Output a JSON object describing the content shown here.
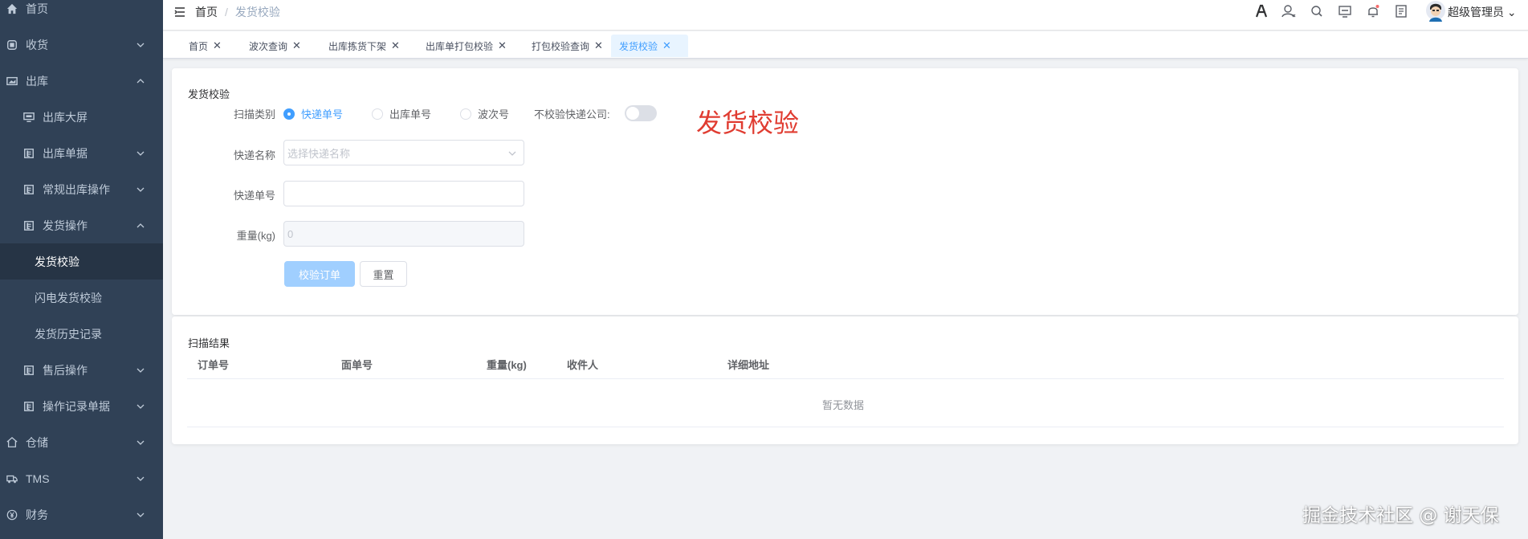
{
  "sidebar": {
    "items": [
      {
        "label": "首页",
        "icon": "home-icon"
      },
      {
        "label": "收货",
        "icon": "receive-icon",
        "arrow": "down"
      },
      {
        "label": "出库",
        "icon": "outbound-icon",
        "arrow": "up"
      },
      {
        "label": "出库大屏",
        "icon": "monitor-icon"
      },
      {
        "label": "出库单据",
        "icon": "document-icon",
        "arrow": "down"
      },
      {
        "label": "常规出库操作",
        "icon": "document-icon",
        "arrow": "down"
      },
      {
        "label": "发货操作",
        "icon": "document-icon",
        "arrow": "up"
      },
      {
        "label": "发货校验",
        "active": true
      },
      {
        "label": "闪电发货校验"
      },
      {
        "label": "发货历史记录"
      },
      {
        "label": "售后操作",
        "icon": "document-icon",
        "arrow": "down"
      },
      {
        "label": "操作记录单据",
        "icon": "document-icon",
        "arrow": "down"
      },
      {
        "label": "仓储",
        "icon": "warehouse-icon",
        "arrow": "down"
      },
      {
        "label": "TMS",
        "icon": "truck-icon",
        "arrow": "down"
      },
      {
        "label": "财务",
        "icon": "yen-icon",
        "arrow": "down"
      }
    ]
  },
  "header": {
    "breadcrumb": {
      "home": "首页",
      "separator": "/",
      "current": "发货校验"
    },
    "user_name": "超级管理员",
    "icons": [
      "font-size-icon",
      "user-icon",
      "search-icon",
      "screen-icon",
      "bell-icon",
      "doc-icon"
    ]
  },
  "tags": [
    {
      "label": "首页"
    },
    {
      "label": "波次查询"
    },
    {
      "label": "出库拣货下架"
    },
    {
      "label": "出库单打包校验"
    },
    {
      "label": "打包校验查询"
    },
    {
      "label": "发货校验",
      "active": true
    }
  ],
  "form": {
    "card_title": "发货校验",
    "scan_type_label": "扫描类别",
    "radios": [
      {
        "label": "快递单号",
        "checked": true
      },
      {
        "label": "出库单号",
        "checked": false
      },
      {
        "label": "波次号",
        "checked": false
      }
    ],
    "no_check_label": "不校验快递公司:",
    "no_check_on": false,
    "express_name_label": "快递名称",
    "express_name_placeholder": "选择快递名称",
    "express_no_label": "快递单号",
    "express_no_value": "",
    "weight_label": "重量(kg)",
    "weight_value": "0",
    "submit_label": "校验订单",
    "reset_label": "重置",
    "big_title": "发货校验"
  },
  "result": {
    "card_title": "扫描结果",
    "columns": [
      "订单号",
      "面单号",
      "重量(kg)",
      "收件人",
      "详细地址"
    ],
    "empty_text": "暂无数据"
  },
  "watermark": "掘金技术社区 @ 谢天保",
  "colors": {
    "sidebar_bg": "#304156",
    "primary": "#409eff",
    "title_red": "#e03c31"
  }
}
